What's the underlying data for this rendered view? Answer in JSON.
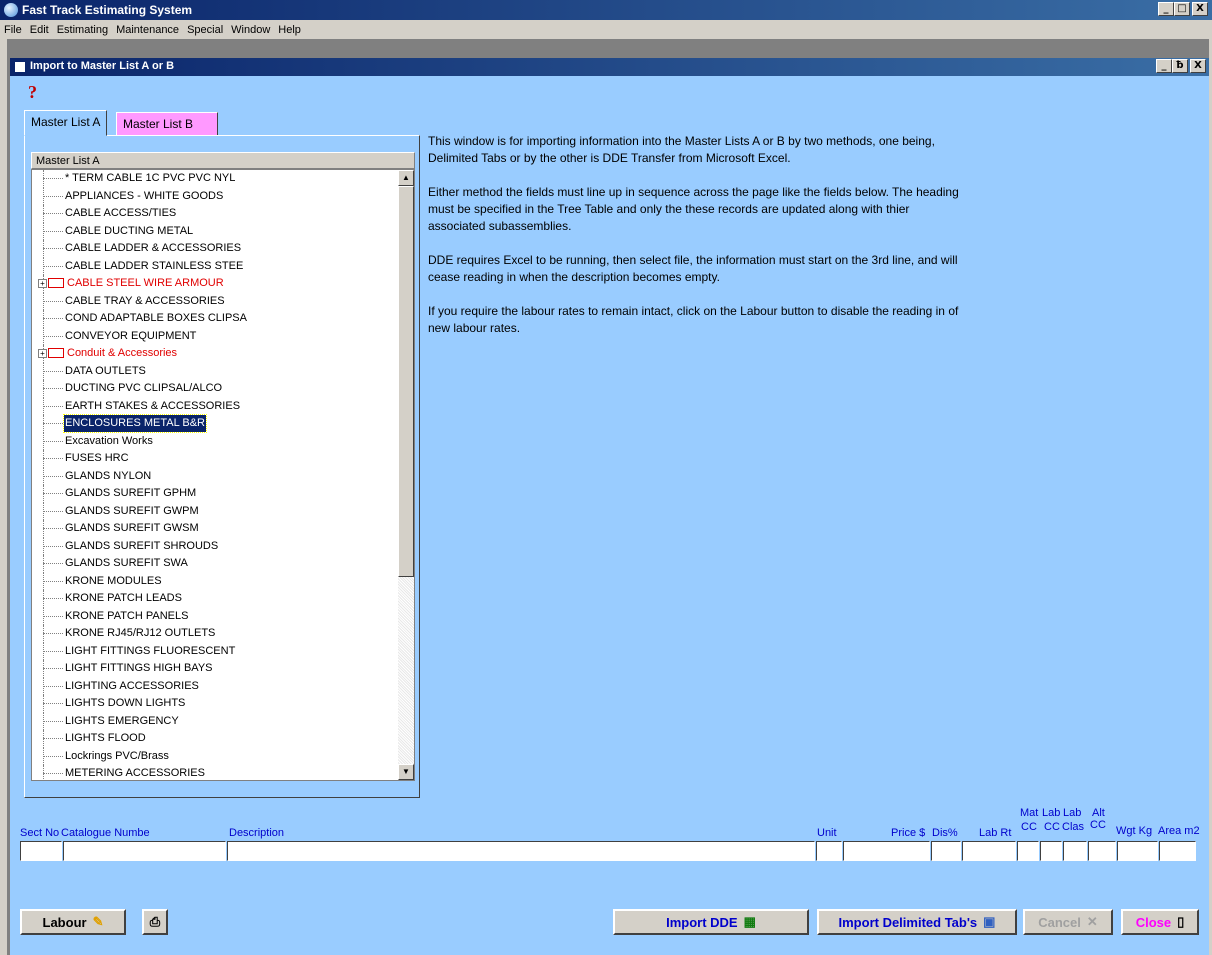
{
  "app": {
    "title": "Fast Track Estimating System",
    "window_buttons": [
      "_",
      "□",
      "X"
    ]
  },
  "menu": [
    "File",
    "Edit",
    "Estimating",
    "Maintenance",
    "Special",
    "Window",
    "Help"
  ],
  "child_window": {
    "title": "Import to Master List A or B",
    "window_buttons": [
      "_",
      "ƀ",
      "X"
    ]
  },
  "tabs": [
    {
      "label": "Master List A",
      "color": "#99ccff",
      "active": true
    },
    {
      "label": "Master List  B",
      "color": "#ff99ff",
      "active": false
    }
  ],
  "tree": {
    "header": "Master List A",
    "items": [
      {
        "label": "* TERM CABLE 1C PVC PVC NYL"
      },
      {
        "label": "APPLIANCES - WHITE GOODS"
      },
      {
        "label": "CABLE ACCESS/TIES"
      },
      {
        "label": "CABLE DUCTING METAL"
      },
      {
        "label": "CABLE LADDER & ACCESSORIES"
      },
      {
        "label": "CABLE LADDER STAINLESS STEE"
      },
      {
        "label": "CABLE STEEL WIRE ARMOUR",
        "expandable": true
      },
      {
        "label": "CABLE TRAY & ACCESSORIES"
      },
      {
        "label": "COND ADAPTABLE BOXES CLIPSA"
      },
      {
        "label": "CONVEYOR EQUIPMENT"
      },
      {
        "label": "Conduit & Accessories",
        "expandable": true
      },
      {
        "label": "DATA OUTLETS"
      },
      {
        "label": "DUCTING PVC CLIPSAL/ALCO"
      },
      {
        "label": "EARTH STAKES & ACCESSORIES"
      },
      {
        "label": "ENCLOSURES METAL B&R",
        "selected": true
      },
      {
        "label": "Excavation Works"
      },
      {
        "label": "FUSES HRC"
      },
      {
        "label": "GLANDS NYLON"
      },
      {
        "label": "GLANDS SUREFIT GPHM"
      },
      {
        "label": "GLANDS SUREFIT GWPM"
      },
      {
        "label": "GLANDS SUREFIT GWSM"
      },
      {
        "label": "GLANDS SUREFIT SHROUDS"
      },
      {
        "label": "GLANDS SUREFIT SWA"
      },
      {
        "label": "KRONE MODULES"
      },
      {
        "label": "KRONE PATCH LEADS"
      },
      {
        "label": "KRONE PATCH PANELS"
      },
      {
        "label": "KRONE RJ45/RJ12 OUTLETS"
      },
      {
        "label": "LIGHT FITTINGS FLUORESCENT"
      },
      {
        "label": "LIGHT FITTINGS HIGH BAYS"
      },
      {
        "label": "LIGHTING ACCESSORIES"
      },
      {
        "label": "LIGHTS DOWN LIGHTS"
      },
      {
        "label": "LIGHTS EMERGENCY"
      },
      {
        "label": "LIGHTS FLOOD"
      },
      {
        "label": "Lockrings PVC/Brass"
      },
      {
        "label": "METERING ACCESSORIES"
      }
    ]
  },
  "info": [
    "This window is for importing information into the Master Lists A or B  by two methods, one being, Delimited Tabs or by the other is DDE Transfer from Microsoft Excel.",
    "Either method the fields must line up in sequence across the page like the fields below. The heading must be specified in the Tree Table and only the these records are updated along with thier associated subassemblies.",
    "DDE requires Excel to be running, then select file, the information must start on the 3rd line, and will cease reading in when the description becomes empty.",
    "If you require the labour rates to remain intact, click on the Labour button to disable the reading in of new labour rates."
  ],
  "fields": {
    "sect_no": "Sect No",
    "catalogue": "Catalogue Numbe",
    "description": "Description",
    "unit": "Unit",
    "price": "Price $",
    "dis": "Dis%",
    "lab_rt": "Lab Rt",
    "mat_cc_top": "Mat",
    "mat_cc_bot": "CC",
    "lab_cc_top": "Lab",
    "lab_cc_bot": "CC",
    "lab_clas_top": "Lab",
    "lab_clas_bot": "Clas",
    "alt_cc_top": "Alt",
    "alt_cc_bot": "CC",
    "wgt": "Wgt Kg",
    "area": "Area m2"
  },
  "buttons": {
    "labour": "Labour",
    "import_dde": "Import DDE",
    "import_tabs": "Import Delimited Tab's",
    "cancel": "Cancel",
    "close": "Close"
  },
  "colors": {
    "client_bg": "#99ccff",
    "tab_b": "#ff99ff",
    "expandable_text": "#e00000",
    "field_label": "#0000cc",
    "close_text": "#ff00ff"
  }
}
